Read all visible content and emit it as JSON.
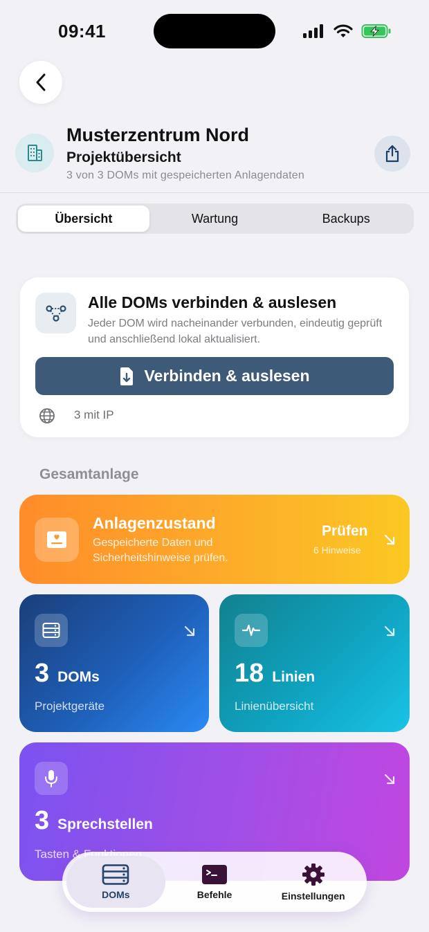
{
  "status": {
    "time": "09:41"
  },
  "header": {
    "title": "Musterzentrum Nord",
    "subtitle": "Projektübersicht",
    "meta": "3 von 3 DOMs mit gespeicherten Anlagendaten"
  },
  "tabs": [
    {
      "label": "Übersicht",
      "active": true
    },
    {
      "label": "Wartung",
      "active": false
    },
    {
      "label": "Backups",
      "active": false
    }
  ],
  "connect_card": {
    "title": "Alle DOMs verbinden & auslesen",
    "description": "Jeder DOM wird nacheinander verbunden, eindeutig geprüft und anschließend lokal aktualisiert.",
    "button_label": "Verbinden & auslesen",
    "ip_info": "3 mit IP"
  },
  "section_title": "Gesamtanlage",
  "status_card": {
    "title": "Anlagenzustand",
    "description": "Gespeicherte Daten und Sicherheitshinweise prüfen.",
    "action": "Prüfen",
    "hint": "6 Hinweise"
  },
  "tiles": {
    "doms": {
      "number": "3",
      "unit": "DOMs",
      "subtitle": "Projektgeräte"
    },
    "lines": {
      "number": "18",
      "unit": "Linien",
      "subtitle": "Linienübersicht"
    },
    "speakers": {
      "number": "3",
      "unit": "Sprechstellen",
      "subtitle": "Tasten & Funktionen"
    }
  },
  "tabbar": [
    {
      "label": "DOMs",
      "icon": "server-icon",
      "active": true
    },
    {
      "label": "Befehle",
      "icon": "terminal-icon",
      "active": false
    },
    {
      "label": "Einstellungen",
      "icon": "gear-icon",
      "active": false
    }
  ],
  "colors": {
    "background": "#f2f2f6",
    "primary_button": "#3d5a78",
    "status_gradient": [
      "#ff8c2a",
      "#fbc823"
    ],
    "doms_gradient": [
      "#1b3f7a",
      "#2b8af5"
    ],
    "lines_gradient": [
      "#12818f",
      "#19c3e5"
    ],
    "speakers_gradient": [
      "#7b52f0",
      "#c146e0"
    ]
  }
}
